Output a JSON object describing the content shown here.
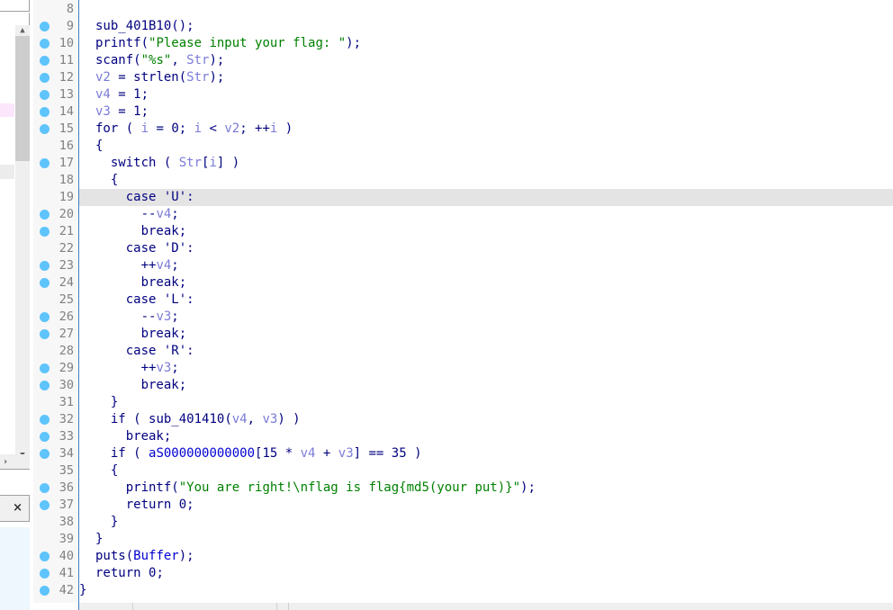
{
  "left_panel": {
    "scroll_up_icon": "▲",
    "scroll_down_icon": "▼",
    "scroll_right_icon": "›",
    "close_icon": "×"
  },
  "editor": {
    "highlighted_line": 19,
    "lines": [
      {
        "num": "8",
        "bp": false,
        "tokens": []
      },
      {
        "num": "9",
        "bp": true,
        "tokens": [
          [
            "f",
            "sub_401B10"
          ],
          [
            "k",
            "();"
          ]
        ]
      },
      {
        "num": "10",
        "bp": true,
        "tokens": [
          [
            "f",
            "printf"
          ],
          [
            "k",
            "("
          ],
          [
            "s",
            "\"Please input your flag: \""
          ],
          [
            "k",
            ");"
          ]
        ]
      },
      {
        "num": "11",
        "bp": true,
        "tokens": [
          [
            "f",
            "scanf"
          ],
          [
            "k",
            "("
          ],
          [
            "s",
            "\"%s\""
          ],
          [
            "k",
            ", "
          ],
          [
            "v",
            "Str"
          ],
          [
            "k",
            ");"
          ]
        ]
      },
      {
        "num": "12",
        "bp": true,
        "tokens": [
          [
            "v",
            "v2"
          ],
          [
            "k",
            " = "
          ],
          [
            "f",
            "strlen"
          ],
          [
            "k",
            "("
          ],
          [
            "v",
            "Str"
          ],
          [
            "k",
            ");"
          ]
        ]
      },
      {
        "num": "13",
        "bp": true,
        "tokens": [
          [
            "v",
            "v4"
          ],
          [
            "k",
            " = "
          ],
          [
            "n",
            "1"
          ],
          [
            "k",
            ";"
          ]
        ]
      },
      {
        "num": "14",
        "bp": true,
        "tokens": [
          [
            "v",
            "v3"
          ],
          [
            "k",
            " = "
          ],
          [
            "n",
            "1"
          ],
          [
            "k",
            ";"
          ]
        ]
      },
      {
        "num": "15",
        "bp": true,
        "tokens": [
          [
            "k",
            "for ( "
          ],
          [
            "v",
            "i"
          ],
          [
            "k",
            " = "
          ],
          [
            "n",
            "0"
          ],
          [
            "k",
            "; "
          ],
          [
            "v",
            "i"
          ],
          [
            "k",
            " < "
          ],
          [
            "v",
            "v2"
          ],
          [
            "k",
            "; ++"
          ],
          [
            "v",
            "i"
          ],
          [
            "k",
            " )"
          ]
        ]
      },
      {
        "num": "16",
        "bp": false,
        "tokens": [
          [
            "k",
            "{"
          ]
        ]
      },
      {
        "num": "17",
        "bp": true,
        "tokens": [
          [
            "k",
            "  switch ( "
          ],
          [
            "v",
            "Str"
          ],
          [
            "k",
            "["
          ],
          [
            "v",
            "i"
          ],
          [
            "k",
            "] )"
          ]
        ]
      },
      {
        "num": "18",
        "bp": false,
        "tokens": [
          [
            "k",
            "  {"
          ]
        ]
      },
      {
        "num": "19",
        "bp": false,
        "tokens": [
          [
            "k",
            "    case "
          ],
          [
            "n",
            "'U'"
          ],
          [
            "k",
            ":"
          ]
        ]
      },
      {
        "num": "20",
        "bp": true,
        "tokens": [
          [
            "k",
            "      --"
          ],
          [
            "v",
            "v4"
          ],
          [
            "k",
            ";"
          ]
        ]
      },
      {
        "num": "21",
        "bp": true,
        "tokens": [
          [
            "k",
            "      break;"
          ]
        ]
      },
      {
        "num": "22",
        "bp": false,
        "tokens": [
          [
            "k",
            "    case "
          ],
          [
            "n",
            "'D'"
          ],
          [
            "k",
            ":"
          ]
        ]
      },
      {
        "num": "23",
        "bp": true,
        "tokens": [
          [
            "k",
            "      ++"
          ],
          [
            "v",
            "v4"
          ],
          [
            "k",
            ";"
          ]
        ]
      },
      {
        "num": "24",
        "bp": true,
        "tokens": [
          [
            "k",
            "      break;"
          ]
        ]
      },
      {
        "num": "25",
        "bp": false,
        "tokens": [
          [
            "k",
            "    case "
          ],
          [
            "n",
            "'L'"
          ],
          [
            "k",
            ":"
          ]
        ]
      },
      {
        "num": "26",
        "bp": true,
        "tokens": [
          [
            "k",
            "      --"
          ],
          [
            "v",
            "v3"
          ],
          [
            "k",
            ";"
          ]
        ]
      },
      {
        "num": "27",
        "bp": true,
        "tokens": [
          [
            "k",
            "      break;"
          ]
        ]
      },
      {
        "num": "28",
        "bp": false,
        "tokens": [
          [
            "k",
            "    case "
          ],
          [
            "n",
            "'R'"
          ],
          [
            "k",
            ":"
          ]
        ]
      },
      {
        "num": "29",
        "bp": true,
        "tokens": [
          [
            "k",
            "      ++"
          ],
          [
            "v",
            "v3"
          ],
          [
            "k",
            ";"
          ]
        ]
      },
      {
        "num": "30",
        "bp": true,
        "tokens": [
          [
            "k",
            "      break;"
          ]
        ]
      },
      {
        "num": "31",
        "bp": false,
        "tokens": [
          [
            "k",
            "  }"
          ]
        ]
      },
      {
        "num": "32",
        "bp": true,
        "tokens": [
          [
            "k",
            "  if ( "
          ],
          [
            "f",
            "sub_401410"
          ],
          [
            "k",
            "("
          ],
          [
            "v",
            "v4"
          ],
          [
            "k",
            ", "
          ],
          [
            "v",
            "v3"
          ],
          [
            "k",
            ") )"
          ]
        ]
      },
      {
        "num": "33",
        "bp": true,
        "tokens": [
          [
            "k",
            "    break;"
          ]
        ]
      },
      {
        "num": "34",
        "bp": true,
        "tokens": [
          [
            "k",
            "  if ( "
          ],
          [
            "g",
            "aS000000000000"
          ],
          [
            "k",
            "["
          ],
          [
            "n",
            "15"
          ],
          [
            "k",
            " * "
          ],
          [
            "v",
            "v4"
          ],
          [
            "k",
            " + "
          ],
          [
            "v",
            "v3"
          ],
          [
            "k",
            "] == "
          ],
          [
            "n",
            "35"
          ],
          [
            "k",
            " )"
          ]
        ]
      },
      {
        "num": "35",
        "bp": false,
        "tokens": [
          [
            "k",
            "  {"
          ]
        ]
      },
      {
        "num": "36",
        "bp": true,
        "tokens": [
          [
            "k",
            "    "
          ],
          [
            "f",
            "printf"
          ],
          [
            "k",
            "("
          ],
          [
            "s",
            "\"You are right!\\nflag is flag{md5(your put)}\""
          ],
          [
            "k",
            ");"
          ]
        ]
      },
      {
        "num": "37",
        "bp": true,
        "tokens": [
          [
            "k",
            "    return "
          ],
          [
            "n",
            "0"
          ],
          [
            "k",
            ";"
          ]
        ]
      },
      {
        "num": "38",
        "bp": false,
        "tokens": [
          [
            "k",
            "  }"
          ]
        ]
      },
      {
        "num": "39",
        "bp": false,
        "tokens": [
          [
            "k",
            "}"
          ]
        ]
      },
      {
        "num": "40",
        "bp": true,
        "tokens": [
          [
            "f",
            "puts"
          ],
          [
            "k",
            "("
          ],
          [
            "g",
            "Buffer"
          ],
          [
            "k",
            ");"
          ]
        ]
      },
      {
        "num": "41",
        "bp": true,
        "tokens": [
          [
            "k",
            "return "
          ],
          [
            "n",
            "0"
          ],
          [
            "k",
            ";"
          ]
        ]
      },
      {
        "num": "42",
        "bp": true,
        "tokens": [
          [
            "k",
            "}"
          ]
        ]
      }
    ]
  }
}
